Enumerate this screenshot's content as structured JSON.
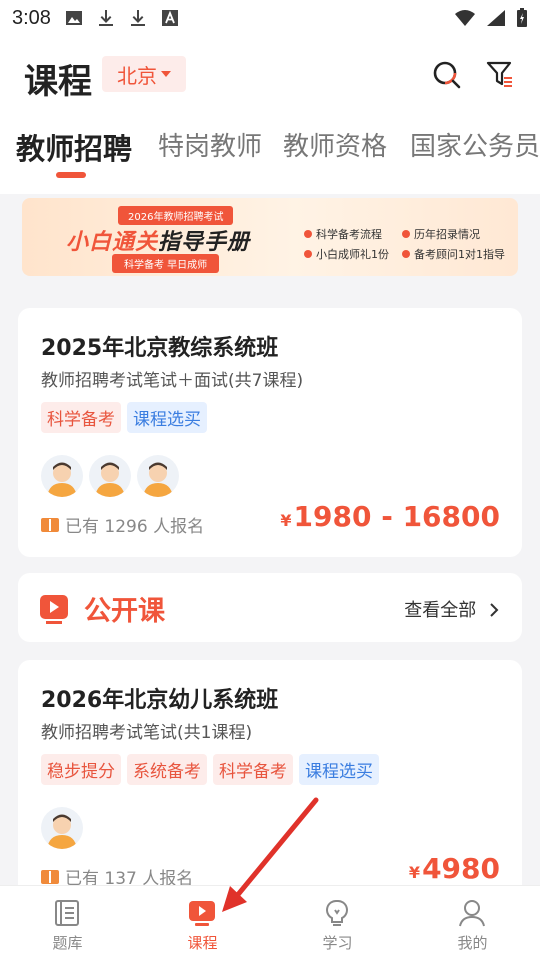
{
  "status_bar": {
    "time": "3:08"
  },
  "header": {
    "title": "课程",
    "city": "北京"
  },
  "tabs": [
    "教师招聘",
    "特岗教师",
    "教师资格",
    "国家公务员"
  ],
  "banner": {
    "subtitle": "2026年教师招聘考试",
    "headline_orange": "小白通关",
    "headline_dark": "指导手册",
    "slogan": "科学备考 早日成师",
    "features": [
      "科学备考流程",
      "历年招录情况",
      "小白成师礼1份",
      "备考顾问1对1指导"
    ]
  },
  "courses": [
    {
      "title": "2025年北京教综系统班",
      "desc": "教师招聘考试笔试＋面试(共7课程)",
      "tags": [
        {
          "text": "科学备考",
          "color": "red"
        },
        {
          "text": "课程选买",
          "color": "blue"
        }
      ],
      "enrolled": "已有 1296 人报名",
      "price_symbol": "¥",
      "price": "1980 - 16800"
    },
    {
      "title": "2026年北京幼儿系统班",
      "desc": "教师招聘考试笔试(共1课程)",
      "tags": [
        {
          "text": "稳步提分",
          "color": "red"
        },
        {
          "text": "系统备考",
          "color": "red"
        },
        {
          "text": "科学备考",
          "color": "red"
        },
        {
          "text": "课程选买",
          "color": "blue"
        }
      ],
      "enrolled": "已有 137 人报名",
      "price_symbol": "¥",
      "price": "4980"
    }
  ],
  "open_course": {
    "title": "公开课",
    "more": "查看全部"
  },
  "bottom_nav": [
    {
      "label": "题库",
      "active": false
    },
    {
      "label": "课程",
      "active": true
    },
    {
      "label": "学习",
      "active": false
    },
    {
      "label": "我的",
      "active": false
    }
  ],
  "colors": {
    "accent": "#f0553a",
    "tag_blue": "#3a7de0"
  }
}
